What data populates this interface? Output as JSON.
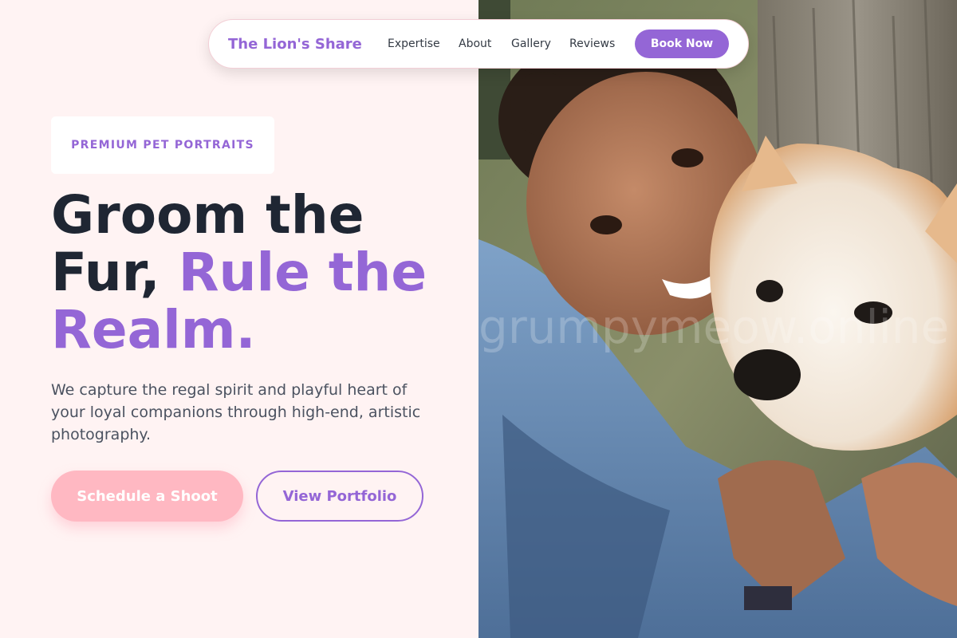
{
  "brand": {
    "name": "The Lion's Share"
  },
  "nav": {
    "links": [
      "Expertise",
      "About",
      "Gallery",
      "Reviews"
    ],
    "cta": "Book Now"
  },
  "hero": {
    "badge": "PREMIUM PET PORTRAITS",
    "headline_part1": "Groom the",
    "headline_part2": "Fur,",
    "headline_accent": "Rule the Realm.",
    "description": "We capture the regal spirit and playful heart of your loyal companions through high-end, artistic photography.",
    "primary_cta": "Schedule a Shoot",
    "secondary_cta": "View Portfolio"
  },
  "photo": {
    "watermark": "grumpymeow.online"
  },
  "colors": {
    "accent": "#9466d6",
    "pink": "#ffb8c2",
    "background": "#fff3f3",
    "heading": "#1f2633"
  }
}
